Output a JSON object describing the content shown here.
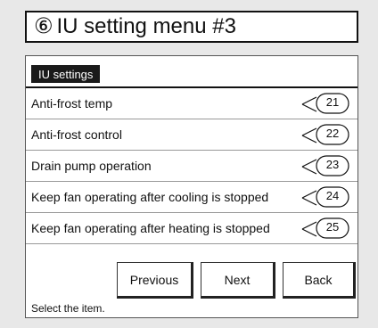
{
  "title": {
    "step_number": "⑥",
    "text": "IU setting menu #3"
  },
  "tab": {
    "label": "IU settings"
  },
  "items": [
    {
      "label": "Anti-frost temp",
      "ref": "21"
    },
    {
      "label": "Anti-frost control",
      "ref": "22"
    },
    {
      "label": "Drain pump operation",
      "ref": "23"
    },
    {
      "label": "Keep fan operating after cooling is stopped",
      "ref": "24"
    },
    {
      "label": "Keep fan operating after heating is stopped",
      "ref": "25"
    }
  ],
  "buttons": {
    "previous": "Previous",
    "next": "Next",
    "back": "Back"
  },
  "status": "Select the item."
}
